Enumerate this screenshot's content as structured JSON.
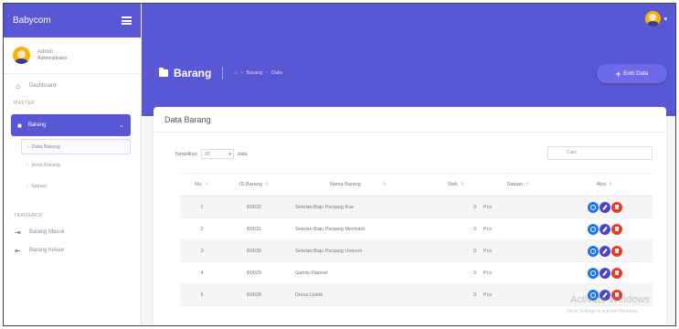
{
  "sidebar": {
    "brand": "Babycom",
    "user_name": "Admin",
    "user_role": "Administrator",
    "dashboard_label": "Dashboard",
    "section_master": "MASTER",
    "active_menu": "Barang",
    "submenu": [
      "Data Barang",
      "Jenis Barang",
      "Satuan"
    ],
    "section_transaksi": "TRANSAKSI",
    "transaksi_items": [
      "Barang Masuk",
      "Barang Keluar"
    ]
  },
  "header": {
    "title": "Barang",
    "breadcrumb": [
      "Barang",
      "Data"
    ],
    "add_button": "Entri Data"
  },
  "card": {
    "title": "Data Barang",
    "show_label": "Tampilkan",
    "show_value": "10",
    "data_label": "data",
    "search_label": "Cari:",
    "columns": [
      "No.",
      "ID Barang",
      "Nama Barang",
      "Stok",
      "Satuan",
      "Aksi"
    ],
    "rows": [
      {
        "no": "1",
        "id": "B0032",
        "nama": "Setelan Baju Panjang Kue",
        "stok": "0",
        "satuan": "Pcs"
      },
      {
        "no": "2",
        "id": "B0031",
        "nama": "Setelan Baju Panjang Mermaid",
        "stok": "0",
        "satuan": "Pcs"
      },
      {
        "no": "3",
        "id": "B0030",
        "nama": "Setelan Baju Panjang Unicorn",
        "stok": "0",
        "satuan": "Pcs"
      },
      {
        "no": "4",
        "id": "B0029",
        "nama": "Gamis Flannel",
        "stok": "0",
        "satuan": "Pcs"
      },
      {
        "no": "5",
        "id": "B0028",
        "nama": "Dress Listrik",
        "stok": "0",
        "satuan": "Pcs"
      }
    ]
  },
  "watermark": {
    "title": "Activate Windows",
    "sub": "Go to Settings to activate Windows."
  },
  "colors": {
    "primary": "#5a57d4",
    "info": "#1e73e8",
    "edit": "#4d43c4",
    "delete": "#e83b2d"
  }
}
